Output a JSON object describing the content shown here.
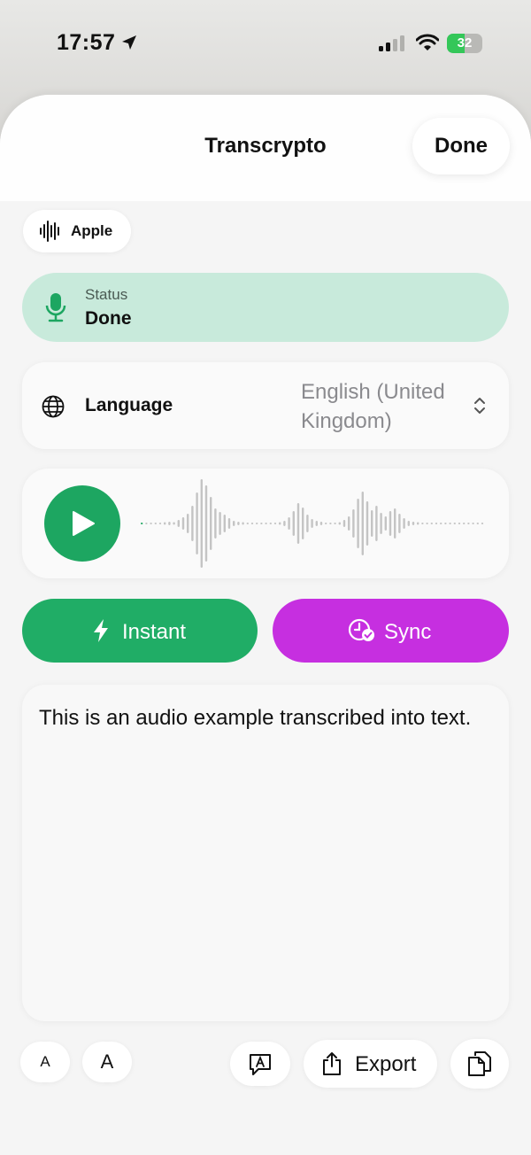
{
  "status_bar": {
    "time": "17:57",
    "battery": "32"
  },
  "sheet": {
    "title": "Transcrypto",
    "done_label": "Done"
  },
  "engine": {
    "label": "Apple"
  },
  "status": {
    "caption": "Status",
    "value": "Done",
    "accent": "#1da661"
  },
  "language": {
    "label": "Language",
    "value": "English (United Kingdom)"
  },
  "player": {
    "progress": 0.0
  },
  "actions": {
    "instant_label": "Instant",
    "instant_color": "#20ad66",
    "sync_label": "Sync",
    "sync_color": "#c62fe0"
  },
  "transcript": {
    "text": "This is an audio example transcribed into text."
  },
  "toolbar": {
    "small_text_label": "A",
    "large_text_label": "A",
    "export_label": "Export"
  },
  "icons": [
    "location-arrow-icon",
    "signal-icon",
    "wifi-icon",
    "battery-icon",
    "waveform-icon",
    "microphone-icon",
    "globe-icon",
    "chevron-up-down-icon",
    "play-icon",
    "bolt-icon",
    "clock-check-icon",
    "translate-bubble-icon",
    "share-icon",
    "copy-icon"
  ]
}
